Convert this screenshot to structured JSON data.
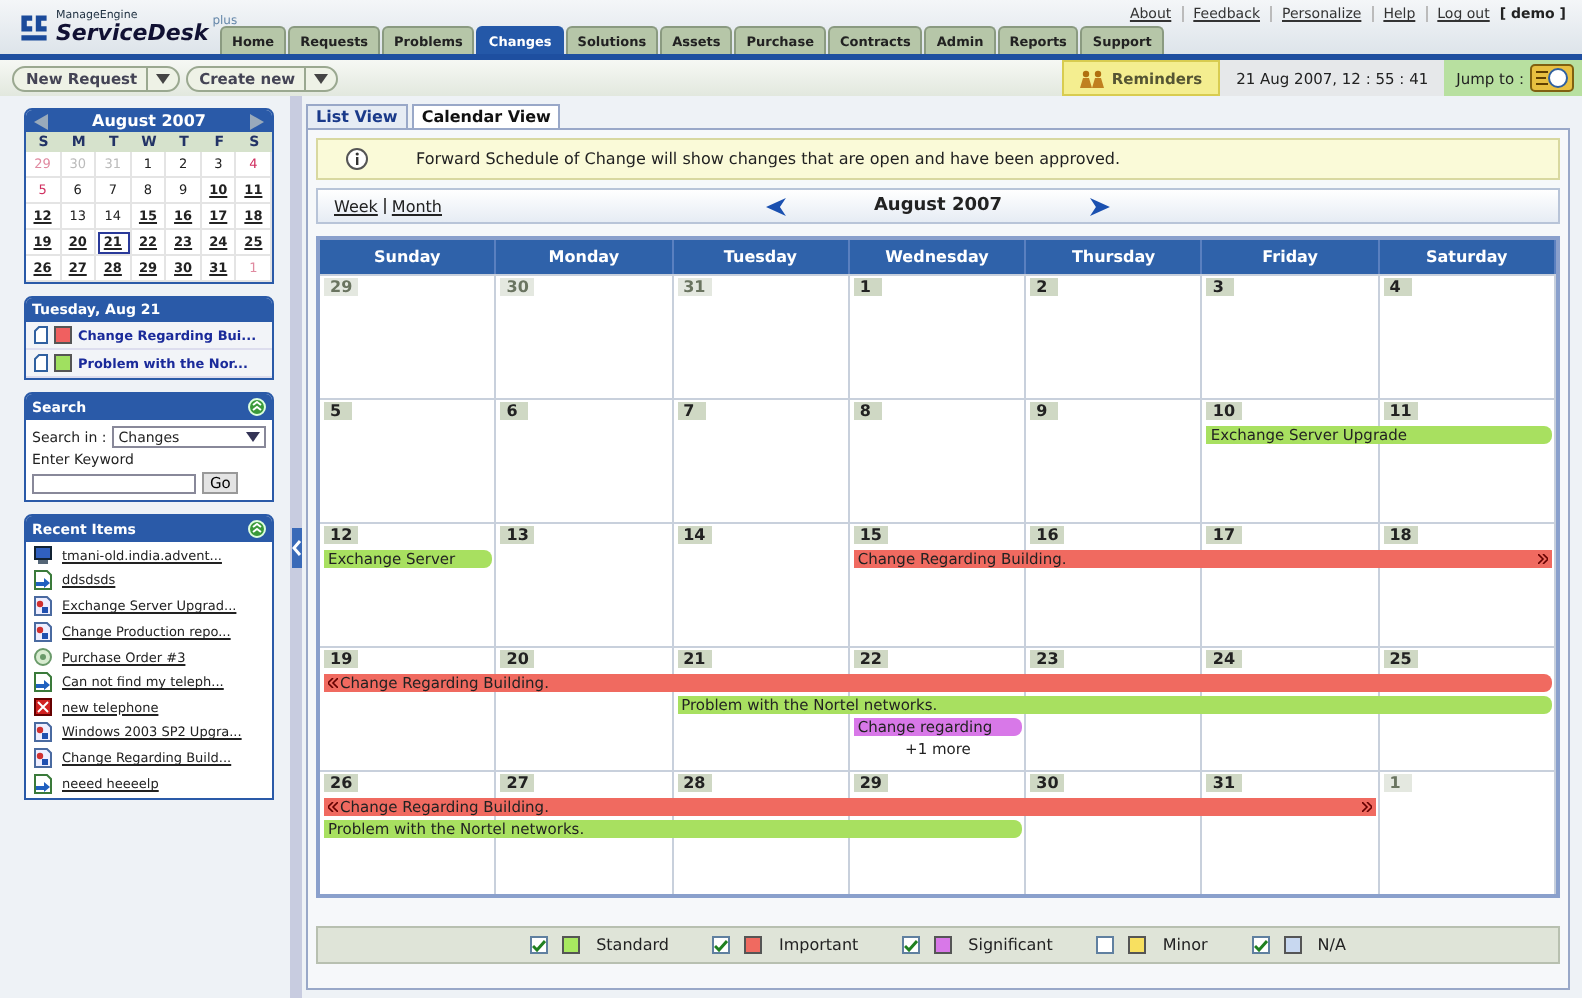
{
  "logo": {
    "brand": "ManageEngine",
    "product": "ServiceDesk",
    "edition": "plus"
  },
  "top_links": [
    {
      "label": "About"
    },
    {
      "label": "Feedback"
    },
    {
      "label": "Personalize"
    },
    {
      "label": "Help"
    },
    {
      "label": "Log out"
    }
  ],
  "user": "[ demo ]",
  "nav_tabs": [
    {
      "label": "Home",
      "selected": false
    },
    {
      "label": "Requests",
      "selected": false
    },
    {
      "label": "Problems",
      "selected": false
    },
    {
      "label": "Changes",
      "selected": true
    },
    {
      "label": "Solutions",
      "selected": false
    },
    {
      "label": "Assets",
      "selected": false
    },
    {
      "label": "Purchase",
      "selected": false
    },
    {
      "label": "Contracts",
      "selected": false
    },
    {
      "label": "Admin",
      "selected": false
    },
    {
      "label": "Reports",
      "selected": false
    },
    {
      "label": "Support",
      "selected": false
    }
  ],
  "toolbar": {
    "buttons": [
      "New Request",
      "Create new"
    ],
    "reminders": "Reminders",
    "datetime": "21 Aug 2007, 12 : 55 : 41",
    "jump_to": "Jump to :"
  },
  "mini_calendar": {
    "title": "August 2007",
    "weekdays": [
      "S",
      "M",
      "T",
      "W",
      "T",
      "F",
      "S"
    ],
    "weeks": [
      [
        {
          "d": "29",
          "muted": true,
          "bold": false,
          "selected": false
        },
        {
          "d": "30",
          "muted": true,
          "bold": false,
          "selected": false
        },
        {
          "d": "31",
          "muted": true,
          "bold": false,
          "selected": false
        },
        {
          "d": "1",
          "muted": false,
          "bold": false,
          "selected": false
        },
        {
          "d": "2",
          "muted": false,
          "bold": false,
          "selected": false
        },
        {
          "d": "3",
          "muted": false,
          "bold": false,
          "selected": false
        },
        {
          "d": "4",
          "muted": false,
          "bold": false,
          "selected": false
        }
      ],
      [
        {
          "d": "5",
          "muted": false,
          "bold": false,
          "selected": false
        },
        {
          "d": "6",
          "muted": false,
          "bold": false,
          "selected": false
        },
        {
          "d": "7",
          "muted": false,
          "bold": false,
          "selected": false
        },
        {
          "d": "8",
          "muted": false,
          "bold": false,
          "selected": false
        },
        {
          "d": "9",
          "muted": false,
          "bold": false,
          "selected": false
        },
        {
          "d": "10",
          "muted": false,
          "bold": true,
          "selected": false
        },
        {
          "d": "11",
          "muted": false,
          "bold": true,
          "selected": false
        }
      ],
      [
        {
          "d": "12",
          "muted": false,
          "bold": true,
          "selected": false
        },
        {
          "d": "13",
          "muted": false,
          "bold": false,
          "selected": false
        },
        {
          "d": "14",
          "muted": false,
          "bold": false,
          "selected": false
        },
        {
          "d": "15",
          "muted": false,
          "bold": true,
          "selected": false
        },
        {
          "d": "16",
          "muted": false,
          "bold": true,
          "selected": false
        },
        {
          "d": "17",
          "muted": false,
          "bold": true,
          "selected": false
        },
        {
          "d": "18",
          "muted": false,
          "bold": true,
          "selected": false
        }
      ],
      [
        {
          "d": "19",
          "muted": false,
          "bold": true,
          "selected": false
        },
        {
          "d": "20",
          "muted": false,
          "bold": true,
          "selected": false
        },
        {
          "d": "21",
          "muted": false,
          "bold": true,
          "selected": true
        },
        {
          "d": "22",
          "muted": false,
          "bold": true,
          "selected": false
        },
        {
          "d": "23",
          "muted": false,
          "bold": true,
          "selected": false
        },
        {
          "d": "24",
          "muted": false,
          "bold": true,
          "selected": false
        },
        {
          "d": "25",
          "muted": false,
          "bold": true,
          "selected": false
        }
      ],
      [
        {
          "d": "26",
          "muted": false,
          "bold": true,
          "selected": false
        },
        {
          "d": "27",
          "muted": false,
          "bold": true,
          "selected": false
        },
        {
          "d": "28",
          "muted": false,
          "bold": true,
          "selected": false
        },
        {
          "d": "29",
          "muted": false,
          "bold": true,
          "selected": false
        },
        {
          "d": "30",
          "muted": false,
          "bold": true,
          "selected": false
        },
        {
          "d": "31",
          "muted": false,
          "bold": true,
          "selected": false
        },
        {
          "d": "1",
          "muted": true,
          "bold": false,
          "selected": false
        }
      ]
    ]
  },
  "day_panel": {
    "title": "Tuesday, Aug 21",
    "items": [
      {
        "title": "Change Regarding Bui...",
        "color": "#f06060"
      },
      {
        "title": "Problem with the Nor...",
        "color": "#a0e060"
      }
    ]
  },
  "search": {
    "title": "Search",
    "search_in_label": "Search in :",
    "search_in": "Changes",
    "keyword_label": "Enter Keyword",
    "go": "Go"
  },
  "recent": {
    "title": "Recent Items",
    "items": [
      {
        "kind": "asset",
        "title": "tmani-old.india.advent..."
      },
      {
        "kind": "request",
        "title": "ddsdsds"
      },
      {
        "kind": "change",
        "title": "Exchange Server Upgrad..."
      },
      {
        "kind": "change",
        "title": "Change Production repo..."
      },
      {
        "kind": "purchase",
        "title": "Purchase Order #3"
      },
      {
        "kind": "request",
        "title": "Can not find my teleph..."
      },
      {
        "kind": "problem",
        "title": "new telephone"
      },
      {
        "kind": "change",
        "title": "Windows 2003 SP2 Upgra..."
      },
      {
        "kind": "change",
        "title": "Change Regarding Build..."
      },
      {
        "kind": "request",
        "title": "neeed heeeelp"
      }
    ]
  },
  "view_tabs": [
    {
      "label": "List View",
      "selected": false
    },
    {
      "label": "Calendar View",
      "selected": true
    }
  ],
  "info": "Forward Schedule of Change will show changes that are open and have been approved.",
  "view_links": [
    "Week",
    "Month"
  ],
  "month_title": "August 2007",
  "weekdays": [
    "Sunday",
    "Monday",
    "Tuesday",
    "Wednesday",
    "Thursday",
    "Friday",
    "Saturday"
  ],
  "weeks": [
    {
      "days": [
        {
          "label": "29",
          "muted": true
        },
        {
          "label": "30",
          "muted": true
        },
        {
          "label": "31",
          "muted": true
        },
        {
          "label": "1",
          "muted": false
        },
        {
          "label": "2",
          "muted": false
        },
        {
          "label": "3",
          "muted": false
        },
        {
          "label": "4",
          "muted": false
        }
      ]
    },
    {
      "days": [
        {
          "label": "5",
          "muted": false
        },
        {
          "label": "6",
          "muted": false
        },
        {
          "label": "7",
          "muted": false
        },
        {
          "label": "8",
          "muted": false
        },
        {
          "label": "9",
          "muted": false
        },
        {
          "label": "10",
          "muted": false,
          "bars": [
            {
              "kind": "start",
              "color": "#a8e060",
              "title": "Exchange Server Upgrade"
            }
          ]
        },
        {
          "label": "11",
          "muted": false,
          "bars": [
            {
              "kind": "end"
            }
          ]
        }
      ]
    },
    {
      "days": [
        {
          "label": "12",
          "muted": false,
          "bars": [
            {
              "kind": "single",
              "color": "#a8e060",
              "title": "Exchange Server"
            }
          ]
        },
        {
          "label": "13",
          "muted": false
        },
        {
          "label": "14",
          "muted": false
        },
        {
          "label": "15",
          "muted": false,
          "bars": [
            {
              "kind": "start",
              "color": "#f06a60",
              "title": "Change Regarding Building."
            }
          ]
        },
        {
          "label": "16",
          "muted": false,
          "bars": [
            {
              "kind": "middle"
            }
          ]
        },
        {
          "label": "17",
          "muted": false,
          "bars": [
            {
              "kind": "middle"
            }
          ]
        },
        {
          "label": "18",
          "muted": false,
          "bars": [
            {
              "kind": "continue_right"
            }
          ]
        }
      ]
    },
    {
      "days": [
        {
          "label": "19",
          "muted": false,
          "bars": [
            {
              "kind": "continue_left",
              "color": "#f06a60",
              "title": "Change Regarding Building."
            }
          ]
        },
        {
          "label": "20",
          "muted": false,
          "bars": [
            {
              "kind": "middle"
            }
          ]
        },
        {
          "label": "21",
          "muted": false,
          "bars": [
            {
              "kind": "middle"
            },
            {
              "kind": "start",
              "color": "#a8e060",
              "title": "Problem with the Nortel networks."
            }
          ]
        },
        {
          "label": "22",
          "muted": false,
          "more": "+1 more",
          "bars": [
            {
              "kind": "middle"
            },
            {
              "kind": "middle"
            },
            {
              "kind": "single",
              "color": "#d878e8",
              "title": "Change regarding"
            }
          ]
        },
        {
          "label": "23",
          "muted": false,
          "bars": [
            {
              "kind": "middle"
            },
            {
              "kind": "middle"
            }
          ]
        },
        {
          "label": "24",
          "muted": false,
          "bars": [
            {
              "kind": "middle"
            },
            {
              "kind": "middle"
            }
          ]
        },
        {
          "label": "25",
          "muted": false,
          "bars": [
            {
              "kind": "end"
            },
            {
              "kind": "end"
            }
          ]
        }
      ]
    },
    {
      "days": [
        {
          "label": "26",
          "muted": false,
          "bars": [
            {
              "kind": "continue_left",
              "color": "#f06a60",
              "title": "Change Regarding Building."
            },
            {
              "kind": "start",
              "color": "#a8e060",
              "title": "Problem with the Nortel networks."
            }
          ]
        },
        {
          "label": "27",
          "muted": false,
          "bars": [
            {
              "kind": "middle"
            },
            {
              "kind": "middle"
            }
          ]
        },
        {
          "label": "28",
          "muted": false,
          "bars": [
            {
              "kind": "middle"
            },
            {
              "kind": "middle"
            }
          ]
        },
        {
          "label": "29",
          "muted": false,
          "bars": [
            {
              "kind": "middle"
            },
            {
              "kind": "end"
            }
          ]
        },
        {
          "label": "30",
          "muted": false,
          "bars": [
            {
              "kind": "middle"
            }
          ]
        },
        {
          "label": "31",
          "muted": false,
          "bars": [
            {
              "kind": "continue_right"
            }
          ]
        },
        {
          "label": "1",
          "muted": true
        }
      ]
    }
  ],
  "legend": [
    {
      "label": "Standard",
      "checked": true,
      "color": "#a8e860"
    },
    {
      "label": "Important",
      "checked": true,
      "color": "#f06a60"
    },
    {
      "label": "Significant",
      "checked": true,
      "color": "#d878e8"
    },
    {
      "label": "Minor",
      "checked": false,
      "color": "#f8e060"
    },
    {
      "label": "N/A",
      "checked": true,
      "color": "#c8d8f0"
    }
  ]
}
